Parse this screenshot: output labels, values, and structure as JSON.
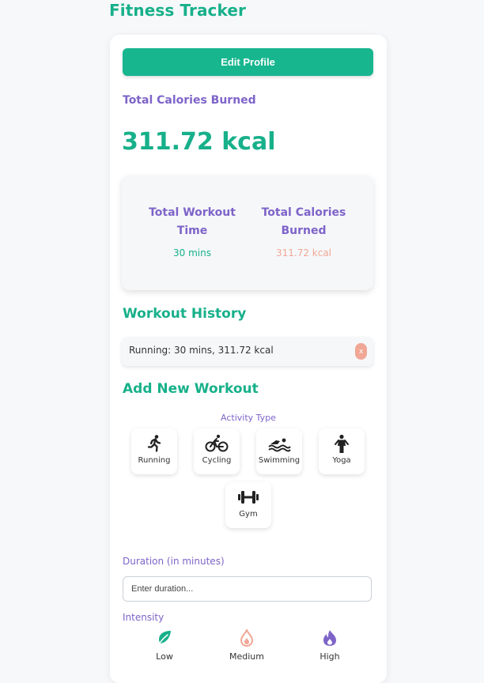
{
  "app": {
    "title": "Fitness Tracker"
  },
  "profile": {
    "edit_label": "Edit Profile"
  },
  "totals": {
    "label": "Total Calories Burned",
    "value": "311.72 kcal"
  },
  "summary": {
    "workout_time_title": "Total Workout Time",
    "workout_time_value": "30 mins",
    "calories_title": "Total Calories Burned",
    "calories_value": "311.72 kcal"
  },
  "history": {
    "title": "Workout History",
    "items": [
      {
        "text": "Running: 30 mins, 311.72 kcal",
        "remove_label": "x"
      }
    ]
  },
  "add_workout": {
    "title": "Add New Workout",
    "activity_type_label": "Activity Type",
    "activities": [
      {
        "label": "Running",
        "icon": "running-icon"
      },
      {
        "label": "Cycling",
        "icon": "bicycle-icon"
      },
      {
        "label": "Swimming",
        "icon": "swimming-icon"
      },
      {
        "label": "Yoga",
        "icon": "yoga-icon"
      },
      {
        "label": "Gym",
        "icon": "dumbbell-icon"
      }
    ],
    "duration_label": "Duration (in minutes)",
    "duration_placeholder": "Enter duration...",
    "intensity_label": "Intensity",
    "intensities": [
      {
        "label": "Low",
        "icon": "leaf-icon",
        "color": "#17b08a"
      },
      {
        "label": "Medium",
        "icon": "flame-icon",
        "color": "#f1a795"
      },
      {
        "label": "High",
        "icon": "fire-icon",
        "color": "#7e64c9"
      }
    ]
  },
  "colors": {
    "accent": "#17b08a",
    "button": "#17b68f",
    "purple": "#7e64c9",
    "salmon": "#f1a795"
  }
}
